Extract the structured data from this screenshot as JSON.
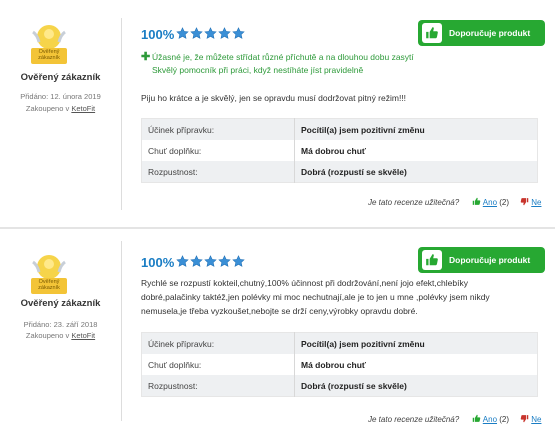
{
  "reviews": [
    {
      "user_label": "Ověřený zákazník",
      "badge_text": "Ověřený zákazník",
      "added_label": "Přidáno:",
      "added_date": "12. února 2019",
      "bought_label": "Zakoupeno v",
      "bought_shop": "KetoFit",
      "rating_percent": "100%",
      "stars": 5,
      "recommend_label": "Doporučuje produkt",
      "pro_text": "Úžasné je, že můžete střídat různé příchutě a na dlouhou dobu zasytí  Skvělý pomocník při práci, když nestíháte jíst pravidelně",
      "body_text": "Piju ho krátce a je skvělý, jen se opravdu musí dodržovat pitný režim!!!",
      "attributes": [
        {
          "key": "Účinek přípravku:",
          "value": "Pocítil(a) jsem pozitivní změnu"
        },
        {
          "key": "Chuť doplňku:",
          "value": "Má dobrou chuť"
        },
        {
          "key": "Rozpustnost:",
          "value": "Dobrá (rozpustí se skvěle)"
        }
      ],
      "useful_question": "Je tato recenze užitečná?",
      "yes_label": "Ano",
      "yes_count": "(2)",
      "no_label": "Ne"
    },
    {
      "user_label": "Ověřený zákazník",
      "badge_text": "Ověřený zákazník",
      "added_label": "Přidáno:",
      "added_date": "23. září 2018",
      "bought_label": "Zakoupeno v",
      "bought_shop": "KetoFit",
      "rating_percent": "100%",
      "stars": 5,
      "recommend_label": "Doporučuje produkt",
      "body_text": "Rychlé se rozpustí kokteil,chutný,100% účinnost při dodržování,není jojo efekt,chlebíky dobré,palačinky taktéž,jen polévky mi moc nechutnají,ale je to jen u mne ,polévky jsem nikdy nemusela,je třeba vyzkoušet,nebojte se drží ceny,výrobky opravdu dobré.",
      "attributes": [
        {
          "key": "Účinek přípravku:",
          "value": "Pocítil(a) jsem pozitivní změnu"
        },
        {
          "key": "Chuť doplňku:",
          "value": "Má dobrou chuť"
        },
        {
          "key": "Rozpustnost:",
          "value": "Dobrá (rozpustí se skvěle)"
        }
      ],
      "useful_question": "Je tato recenze užitečná?",
      "yes_label": "Ano",
      "yes_count": "(2)",
      "no_label": "Ne"
    }
  ],
  "colors": {
    "accent_blue": "#1a7dc4",
    "recommend_green": "#27a832",
    "pro_green": "#2e9a3a",
    "star_blue": "#3a8fd6"
  }
}
